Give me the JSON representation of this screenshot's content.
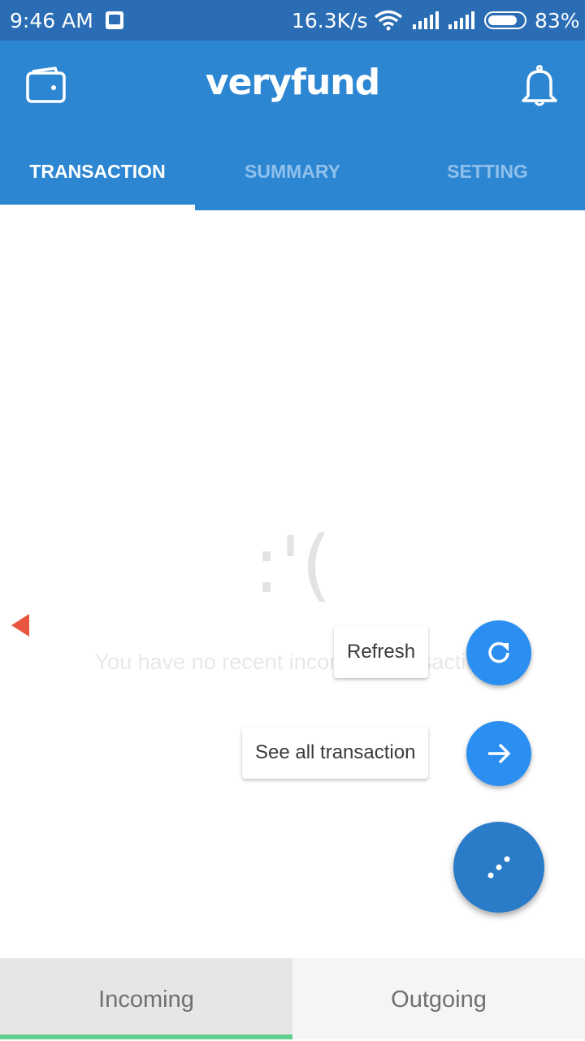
{
  "status_bar": {
    "time": "9:46  AM",
    "speed": "16.3K/s",
    "battery_percent": "83%",
    "battery_level": 0.83
  },
  "app_bar": {
    "brand": "veryfund",
    "tabs": [
      {
        "label": "TRANSACTION",
        "active": true
      },
      {
        "label": "SUMMARY",
        "active": false
      },
      {
        "label": "SETTING",
        "active": false
      }
    ]
  },
  "content": {
    "empty_emoticon": ":'(",
    "empty_message": "You have no recent incoming transaction"
  },
  "fab_menu": {
    "refresh_label": "Refresh",
    "see_all_label": "See all transaction"
  },
  "bottom_tabs": [
    {
      "label": "Incoming",
      "active": true
    },
    {
      "label": "Outgoing",
      "active": false
    }
  ],
  "icons": {
    "wallet": "wallet-icon",
    "bell": "bell-icon",
    "refresh": "refresh-icon",
    "arrow": "arrow-right-icon",
    "more": "more-dots-icon",
    "previous": "caret-left-icon"
  },
  "colors": {
    "app_bar": "#2d86d2",
    "status_bar": "#2a6db5",
    "fab": "#2a8ff0",
    "main_fab": "#2a7bc8",
    "indicator_green": "#5fce8e",
    "arrow_red": "#e8563f"
  }
}
